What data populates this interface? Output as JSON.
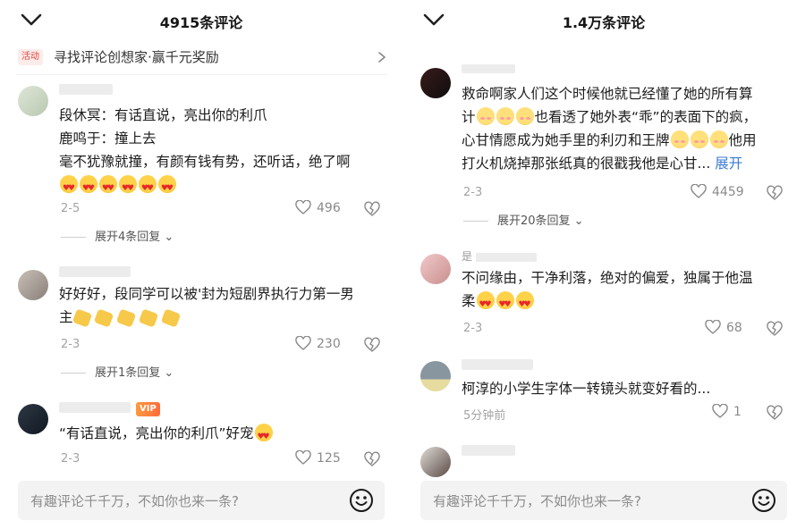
{
  "left": {
    "header": {
      "title": "4915条评论"
    },
    "promo": {
      "badge": "活动",
      "text": "寻找评论创想家·赢千元奖励"
    },
    "comments": [
      {
        "lines": [
          "段休冥：有话直说，亮出你的利爪",
          "鹿鸣于：撞上去",
          "毫不犹豫就撞，有颜有钱有势，还听话，绝了啊"
        ],
        "date": "2-5",
        "likes": "496",
        "replies": "展开4条回复"
      },
      {
        "lines": [
          "好好好，段同学可以被'封为短剧界执行力第一男",
          "主"
        ],
        "date": "2-3",
        "likes": "230",
        "replies": "展开1条回复"
      },
      {
        "badge": "VIP",
        "lines": [
          "“有话直说，亮出你的利爪”好宠"
        ],
        "date": "2-3",
        "likes": "125"
      }
    ],
    "composer": {
      "placeholder": "有趣评论千千万，不如你也来一条?"
    }
  },
  "right": {
    "header": {
      "title": "1.4万条评论"
    },
    "comments": [
      {
        "lines": [
          "救命啊家人们这个时候他就已经懂了她的所有算",
          "计",
          "也看透了她外表“乖”的表面下的疯，",
          "心甘情愿成为她手里的利刃和王牌",
          "他用",
          "打火机烧掉那张纸真的很戳我他是心甘..."
        ],
        "expand": "展开",
        "date": "2-3",
        "likes": "4459",
        "replies": "展开20条回复"
      },
      {
        "uname": "是",
        "lines": [
          "不问缘由，干净利落，绝对的偏爱，独属于他温",
          "柔"
        ],
        "date": "2-3",
        "likes": "68"
      },
      {
        "lines": [
          "柯淳的小学生字体一转镜头就变好看的..."
        ],
        "date": "5分钟前",
        "likes": "1"
      }
    ],
    "composer": {
      "placeholder": "有趣评论千千万，不如你也来一条?"
    }
  },
  "icons": [
    "chevron-down-icon",
    "chevron-right-icon",
    "heart-icon",
    "dislike-icon",
    "smile-icon"
  ],
  "colors": {
    "accent_red": "#e3453b",
    "link_blue": "#3b7bd6",
    "muted": "#a3a3a3"
  }
}
